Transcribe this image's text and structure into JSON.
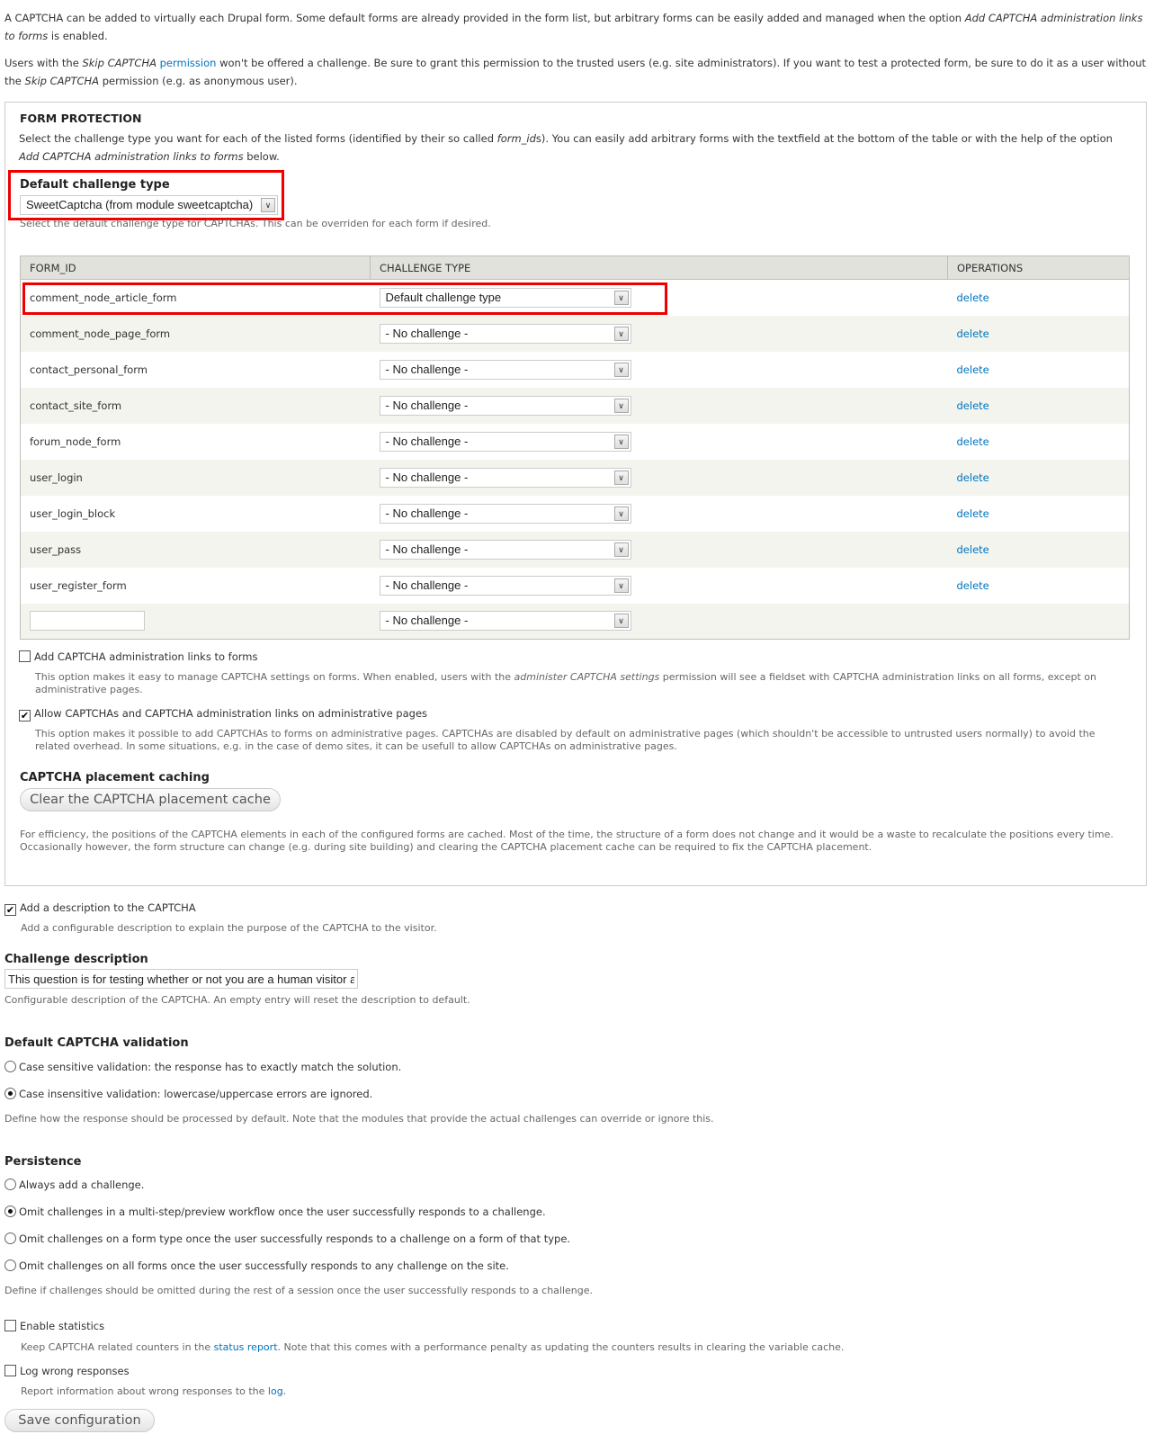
{
  "intro": {
    "p1_a": "A CAPTCHA can be added to virtually each Drupal form. Some default forms are already provided in the form list, but arbitrary forms can be easily added and managed when the option ",
    "p1_em": "Add CAPTCHA administration links to forms",
    "p1_b": " is enabled.",
    "p2_a": "Users with the ",
    "p2_em1": "Skip CAPTCHA",
    "p2_link": "permission",
    "p2_b": " won't be offered a challenge. Be sure to grant this permission to the trusted users (e.g. site administrators). If you want to test a protected form, be sure to do it as a user without the ",
    "p2_em2": "Skip CAPTCHA",
    "p2_c": " permission (e.g. as anonymous user)."
  },
  "form_protection": {
    "legend": "FORM PROTECTION",
    "desc_a": "Select the challenge type you want for each of the listed forms (identified by their so called ",
    "desc_em1": "form_id",
    "desc_b": "s). You can easily add arbitrary forms with the textfield at the bottom of the table or with the help of the option ",
    "desc_em2": "Add CAPTCHA administration links to forms",
    "desc_c": " below.",
    "default_label": "Default challenge type",
    "default_value": "SweetCaptcha (from module sweetcaptcha)",
    "default_desc": "Select the default challenge type for CAPTCHAs. This can be overriden for each form if desired.",
    "highlight_color": "#e00000",
    "table": {
      "headers": [
        "FORM_ID",
        "CHALLENGE TYPE",
        "OPERATIONS"
      ],
      "rows": [
        {
          "form_id": "comment_node_article_form",
          "challenge": "Default challenge type",
          "op": "delete"
        },
        {
          "form_id": "comment_node_page_form",
          "challenge": "- No challenge -",
          "op": "delete"
        },
        {
          "form_id": "contact_personal_form",
          "challenge": "- No challenge -",
          "op": "delete"
        },
        {
          "form_id": "contact_site_form",
          "challenge": "- No challenge -",
          "op": "delete"
        },
        {
          "form_id": "forum_node_form",
          "challenge": "- No challenge -",
          "op": "delete"
        },
        {
          "form_id": "user_login",
          "challenge": "- No challenge -",
          "op": "delete"
        },
        {
          "form_id": "user_login_block",
          "challenge": "- No challenge -",
          "op": "delete"
        },
        {
          "form_id": "user_pass",
          "challenge": "- No challenge -",
          "op": "delete"
        },
        {
          "form_id": "user_register_form",
          "challenge": "- No challenge -",
          "op": "delete"
        }
      ],
      "new_row": {
        "form_id": "",
        "challenge": "- No challenge -"
      }
    },
    "admin_links": {
      "label": "Add CAPTCHA administration links to forms",
      "checked": false,
      "desc_a": "This option makes it easy to manage CAPTCHA settings on forms. When enabled, users with the ",
      "desc_em": "administer CAPTCHA settings",
      "desc_b": " permission will see a fieldset with CAPTCHA administration links on all forms, except on administrative pages."
    },
    "allow_admin": {
      "label": "Allow CAPTCHAs and CAPTCHA administration links on administrative pages",
      "checked": true,
      "desc": "This option makes it possible to add CAPTCHAs to forms on administrative pages. CAPTCHAs are disabled by default on administrative pages (which shouldn't be accessible to untrusted users normally) to avoid the related overhead. In some situations, e.g. in the case of demo sites, it can be usefull to allow CAPTCHAs on administrative pages."
    },
    "caching": {
      "label": "CAPTCHA placement caching",
      "button": "Clear the CAPTCHA placement cache",
      "desc": "For efficiency, the positions of the CAPTCHA elements in each of the configured forms are cached. Most of the time, the structure of a form does not change and it would be a waste to recalculate the positions every time. Occasionally however, the form structure can change (e.g. during site building) and clearing the CAPTCHA placement cache can be required to fix the CAPTCHA placement."
    }
  },
  "add_description": {
    "label": "Add a description to the CAPTCHA",
    "checked": true,
    "desc": "Add a configurable description to explain the purpose of the CAPTCHA to the visitor."
  },
  "challenge_description": {
    "label": "Challenge description",
    "value": "This question is for testing whether or not you are a human visitor and",
    "desc": "Configurable description of the CAPTCHA. An empty entry will reset the description to default."
  },
  "validation": {
    "label": "Default CAPTCHA validation",
    "options": [
      {
        "label": "Case sensitive validation: the response has to exactly match the solution.",
        "selected": false
      },
      {
        "label": "Case insensitive validation: lowercase/uppercase errors are ignored.",
        "selected": true
      }
    ],
    "desc": "Define how the response should be processed by default. Note that the modules that provide the actual challenges can override or ignore this."
  },
  "persistence": {
    "label": "Persistence",
    "options": [
      {
        "label": "Always add a challenge.",
        "selected": false
      },
      {
        "label": "Omit challenges in a multi-step/preview workflow once the user successfully responds to a challenge.",
        "selected": true
      },
      {
        "label": "Omit challenges on a form type once the user successfully responds to a challenge on a form of that type.",
        "selected": false
      },
      {
        "label": "Omit challenges on all forms once the user successfully responds to any challenge on the site.",
        "selected": false
      }
    ],
    "desc": "Define if challenges should be omitted during the rest of a session once the user successfully responds to a challenge."
  },
  "statistics": {
    "label": "Enable statistics",
    "checked": false,
    "desc_a": "Keep CAPTCHA related counters in the ",
    "desc_link": "status report",
    "desc_b": ". Note that this comes with a performance penalty as updating the counters results in clearing the variable cache."
  },
  "log": {
    "label": "Log wrong responses",
    "checked": false,
    "desc_a": "Report information about wrong responses to the ",
    "desc_link": "log",
    "desc_b": "."
  },
  "save_button": "Save configuration"
}
